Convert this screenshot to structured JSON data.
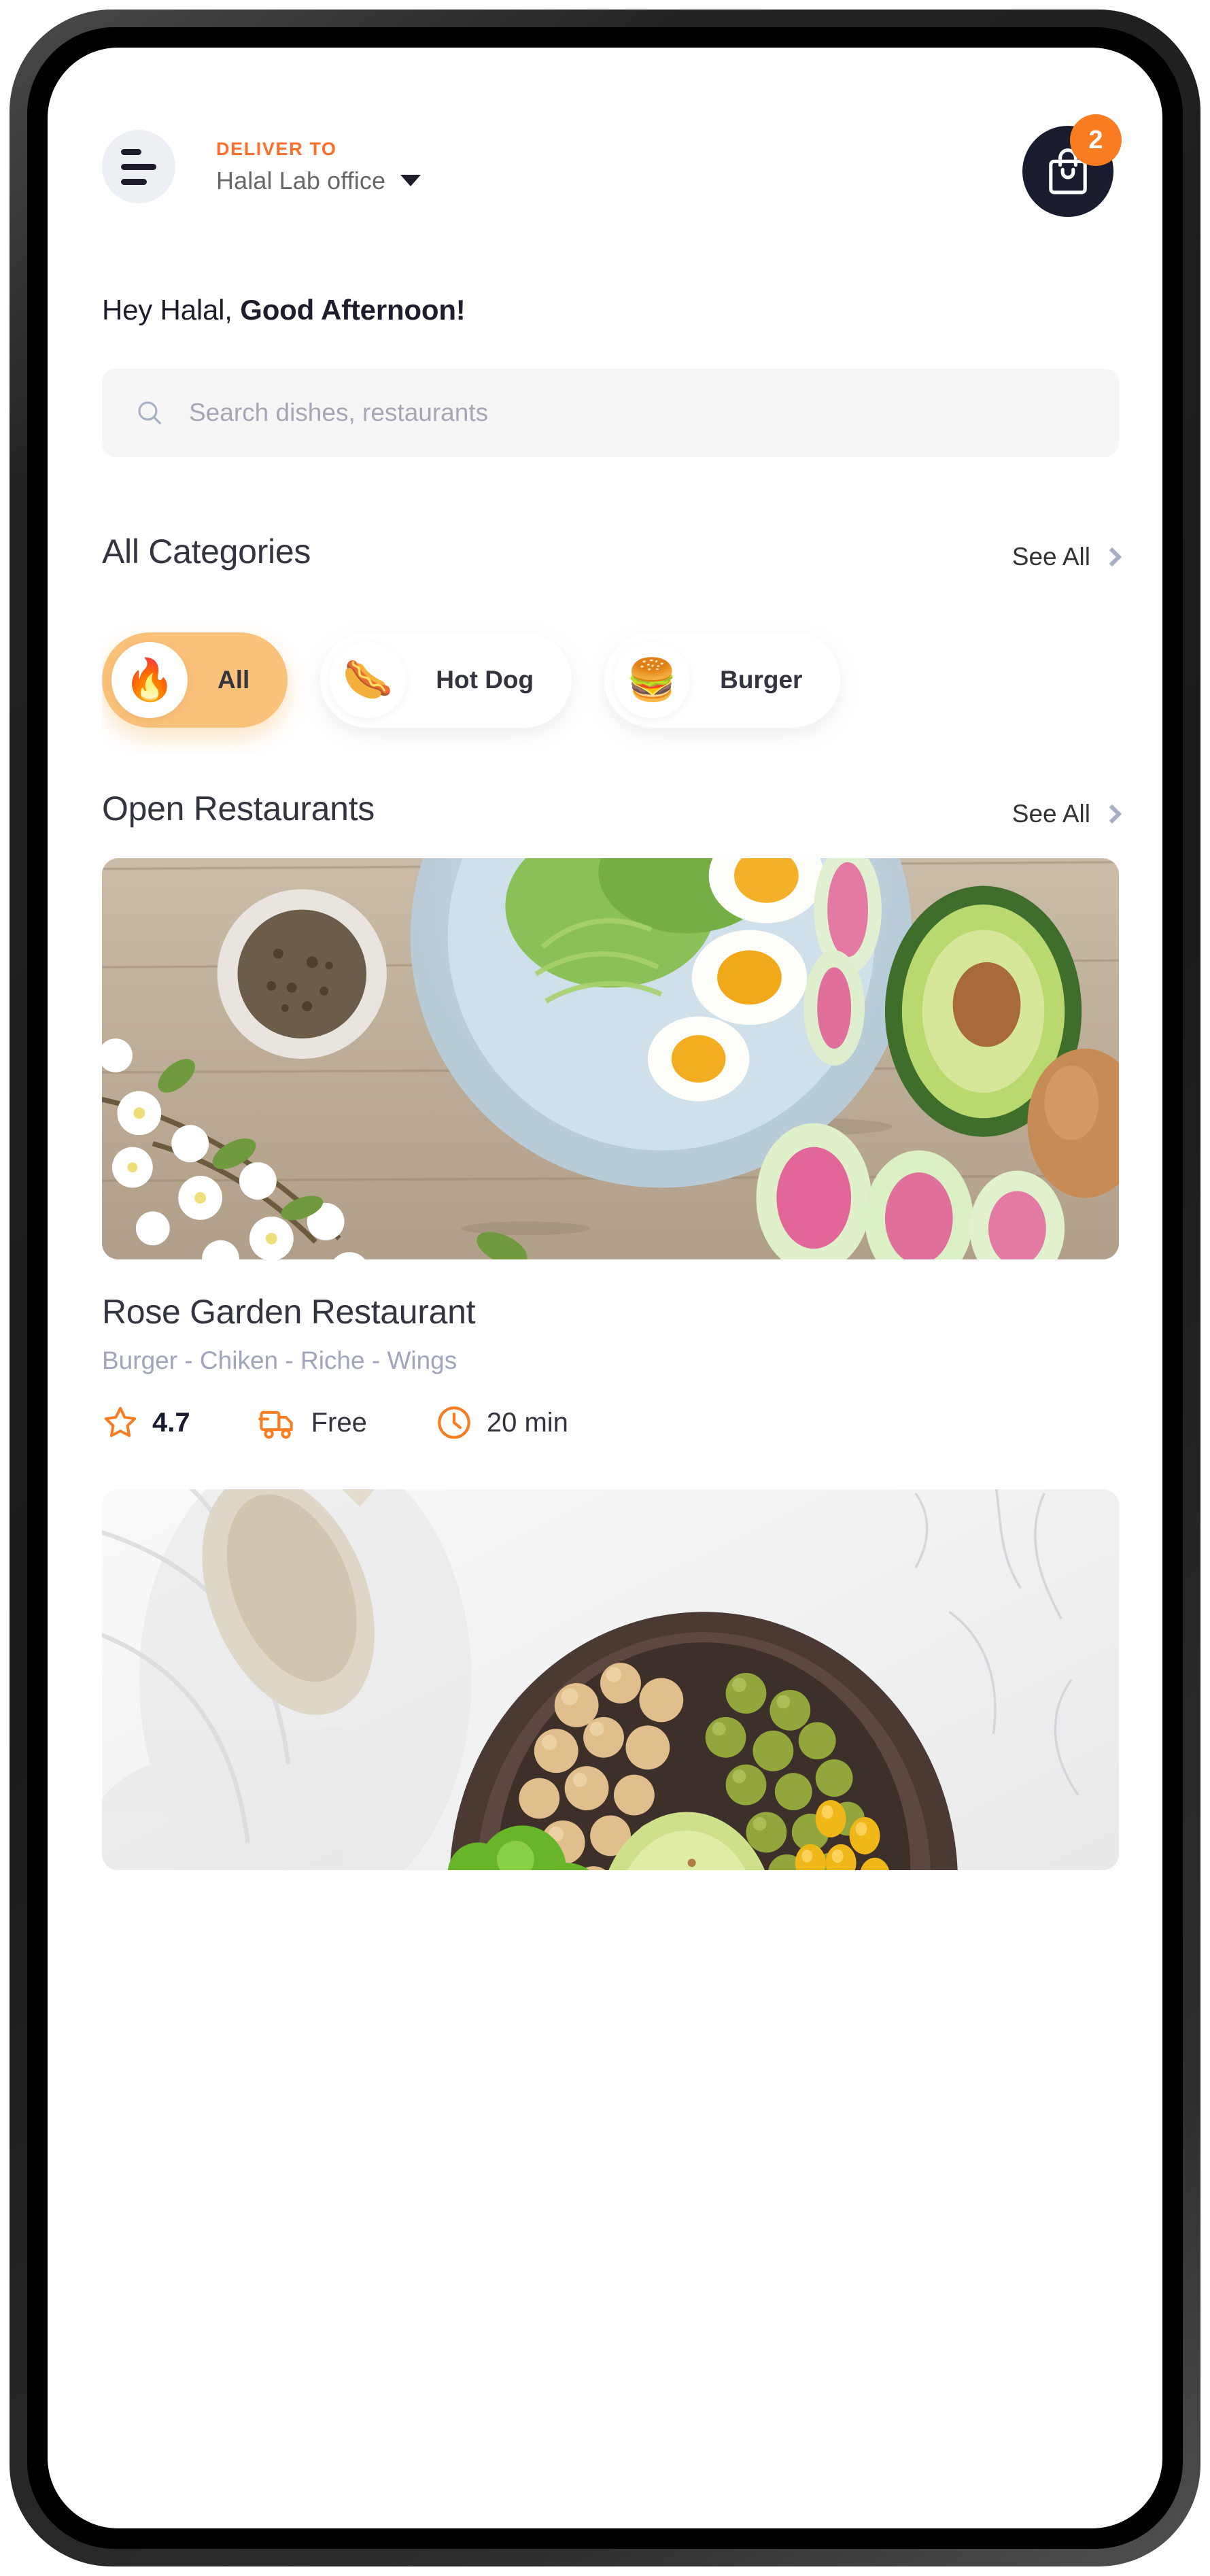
{
  "header": {
    "menu_icon": "hamburger-menu-icon",
    "deliver_label": "DELIVER TO",
    "deliver_value": "Halal Lab office",
    "dropdown_icon": "caret-down-icon",
    "cart_icon": "shopping-bag-icon",
    "cart_count": "2"
  },
  "greeting": {
    "prefix": "Hey Halal, ",
    "emphasis": "Good Afternoon!"
  },
  "search": {
    "icon": "search-icon",
    "placeholder": "Search dishes, restaurants",
    "value": ""
  },
  "categories_section": {
    "title": "All Categories",
    "see_all_label": "See All",
    "see_all_icon": "chevron-right-icon",
    "chips": [
      {
        "label": "All",
        "emoji": "🔥",
        "icon_name": "fire-emoji-icon",
        "active": true
      },
      {
        "label": "Hot Dog",
        "emoji": "🌭",
        "icon_name": "hot-dog-emoji-icon",
        "active": false
      },
      {
        "label": "Burger",
        "emoji": "🍔",
        "icon_name": "burger-emoji-icon",
        "active": false
      }
    ]
  },
  "restaurants_section": {
    "title": "Open Restaurants",
    "see_all_label": "See All",
    "see_all_icon": "chevron-right-icon",
    "cards": [
      {
        "name": "Rose Garden Restaurant",
        "tags": "Burger - Chiken - Riche - Wings",
        "rating": "4.7",
        "rating_icon": "star-icon",
        "delivery": "Free",
        "delivery_icon": "delivery-truck-icon",
        "time": "20 min",
        "time_icon": "clock-icon",
        "photo_alt": "salad-plate-on-wooden-table-photo"
      },
      {
        "name": "",
        "tags": "",
        "rating": "",
        "delivery": "",
        "time": "",
        "photo_alt": "buddha-bowl-on-marble-photo"
      }
    ]
  },
  "colors": {
    "accent_orange": "#fc6e2a",
    "badge_orange": "#f97d20",
    "chip_active": "#fac17a",
    "dark_navy": "#181c2e",
    "text_dark": "#32343e",
    "text_muted": "#a0a5ba",
    "search_bg": "#f6f6f6",
    "menu_bg": "#ecf0f4"
  }
}
